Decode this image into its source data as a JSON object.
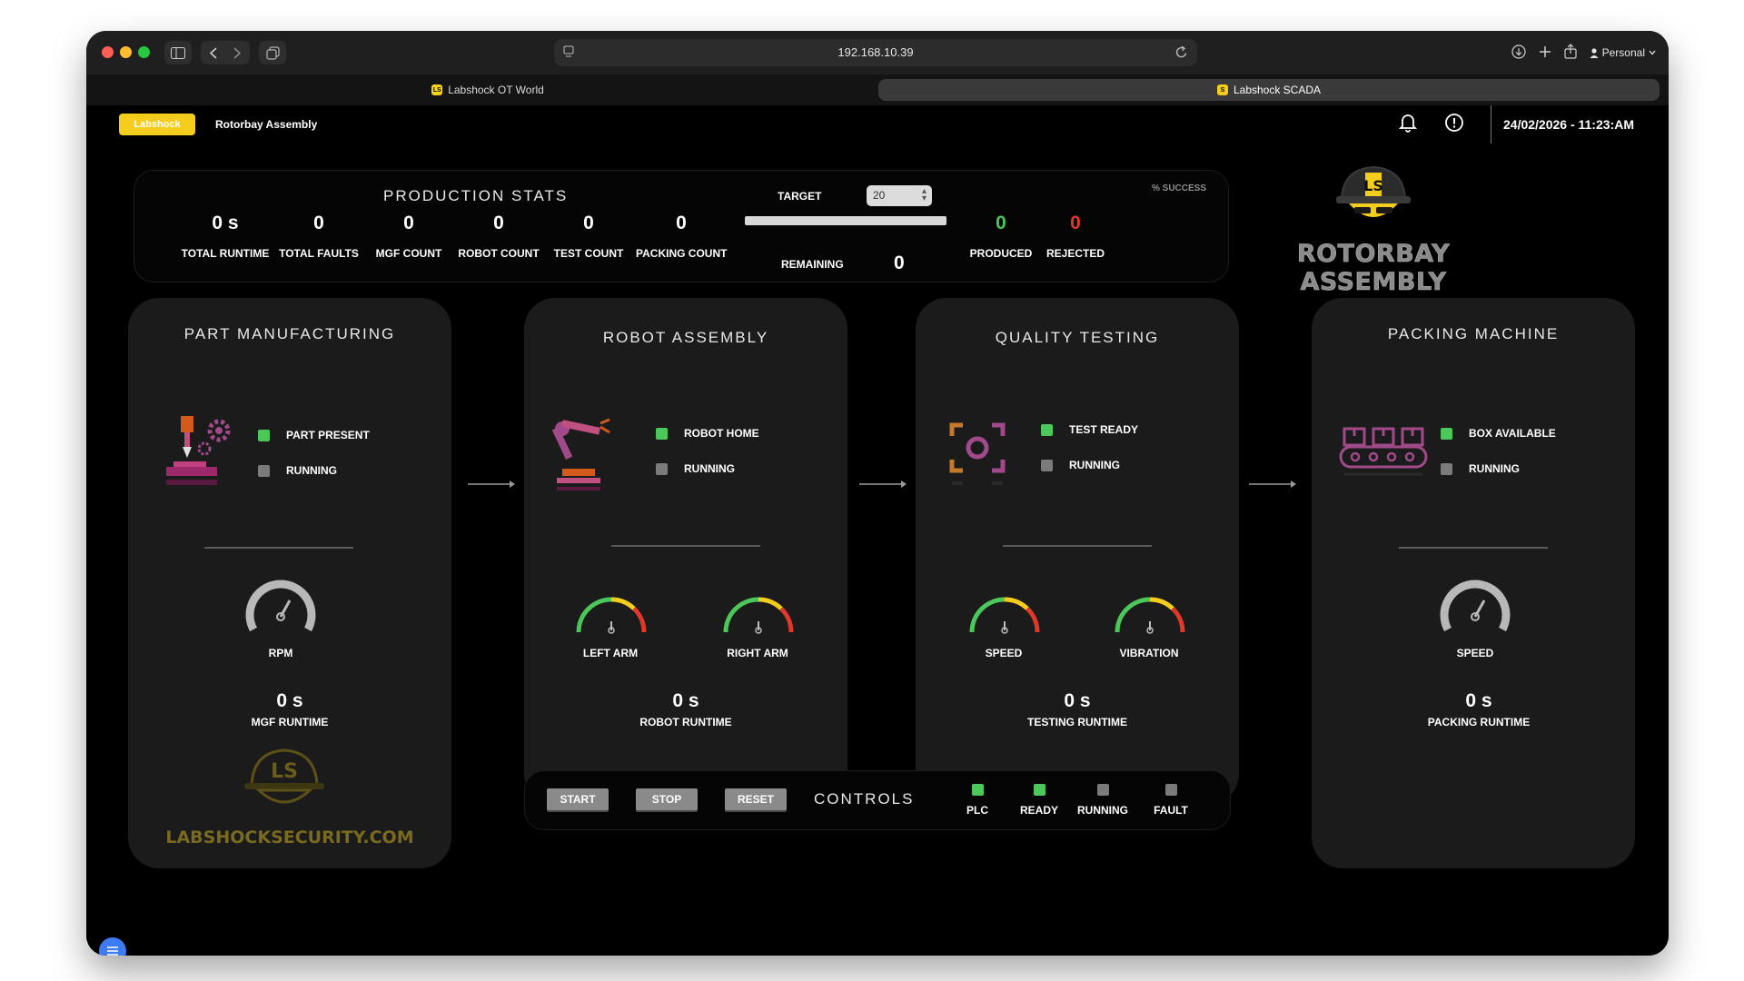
{
  "browser": {
    "url": "192.168.10.39",
    "profile": "Personal",
    "tabs": [
      {
        "label": "Labshock OT World",
        "favicon": "LS"
      },
      {
        "label": "Labshock SCADA",
        "favicon": "S"
      }
    ]
  },
  "header": {
    "brand": "Labshock",
    "project": "Rotorbay Assembly",
    "datetime": "24/02/2026 - 11:23:AM"
  },
  "stats": {
    "title": "PRODUCTION STATS",
    "items": [
      {
        "value": "0 s",
        "label": "TOTAL RUNTIME"
      },
      {
        "value": "0",
        "label": "TOTAL FAULTS"
      },
      {
        "value": "0",
        "label": "MGF COUNT"
      },
      {
        "value": "0",
        "label": "ROBOT COUNT"
      },
      {
        "value": "0",
        "label": "TEST COUNT"
      },
      {
        "value": "0",
        "label": "PACKING COUNT"
      }
    ],
    "target_label": "TARGET",
    "target_value": "20",
    "progress_fraction": 1.0,
    "remaining_label": "REMAINING",
    "remaining_value": "0",
    "success_label": "% SUCCESS",
    "produced": {
      "value": "0",
      "label": "PRODUCED"
    },
    "rejected": {
      "value": "0",
      "label": "REJECTED"
    }
  },
  "logo": {
    "title": "ROTORBAY ASSEMBLY"
  },
  "cards": {
    "manufacturing": {
      "title": "PART MANUFACTURING",
      "ind1": "PART PRESENT",
      "ind2": "RUNNING",
      "gauge": "RPM",
      "runtime_value": "0 s",
      "runtime_label": "MGF RUNTIME",
      "site": "LABSHOCKSECURITY.COM"
    },
    "robot": {
      "title": "ROBOT ASSEMBLY",
      "ind1": "ROBOT HOME",
      "ind2": "RUNNING",
      "gauge1": "LEFT ARM",
      "gauge2": "RIGHT ARM",
      "runtime_value": "0 s",
      "runtime_label": "ROBOT RUNTIME"
    },
    "quality": {
      "title": "QUALITY TESTING",
      "ind1": "TEST READY",
      "ind2": "RUNNING",
      "gauge1": "SPEED",
      "gauge2": "VIBRATION",
      "runtime_value": "0 s",
      "runtime_label": "TESTING RUNTIME"
    },
    "packing": {
      "title": "PACKING MACHINE",
      "ind1": "BOX AVAILABLE",
      "ind2": "RUNNING",
      "gauge": "SPEED",
      "runtime_value": "0 s",
      "runtime_label": "PACKING RUNTIME"
    }
  },
  "controls": {
    "title": "CONTROLS",
    "start": "START",
    "stop": "STOP",
    "reset": "RESET",
    "indicators": [
      {
        "label": "PLC",
        "state": "on"
      },
      {
        "label": "READY",
        "state": "on"
      },
      {
        "label": "RUNNING",
        "state": "off"
      },
      {
        "label": "FAULT",
        "state": "off"
      }
    ]
  },
  "colors": {
    "brand_yellow": "#f5cd1d",
    "indicator_on": "#4cc85a",
    "indicator_off": "#7b7b7b",
    "produced_green": "#4cc85a",
    "rejected_red": "#e0392b"
  }
}
